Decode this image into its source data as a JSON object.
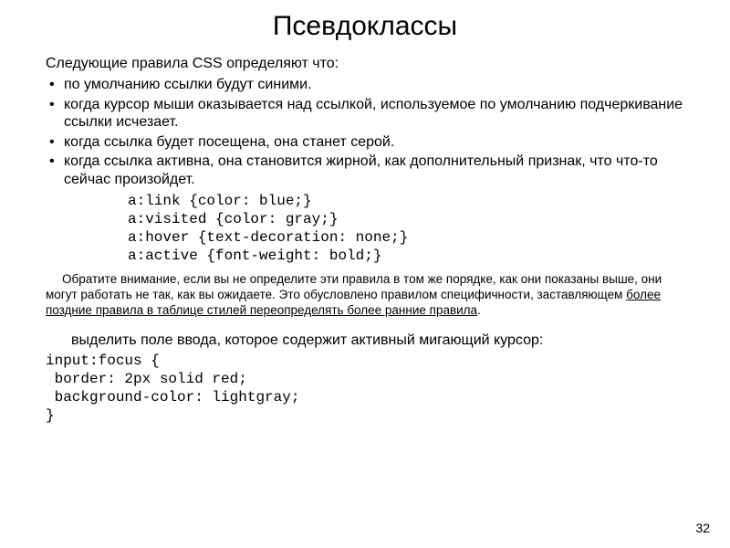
{
  "title": "Псевдоклассы",
  "intro": "Следующие правила CSS определяют что:",
  "bullets": [
    "по умолчанию ссылки будут синими.",
    "когда курсор мыши оказывается над ссылкой, используемое по умолчанию подчеркивание ссылки исчезает.",
    "когда ссылка будет посещена, она станет серой.",
    "когда ссылка активна, она становится жирной, как дополнительный признак, что что-то сейчас произойдет."
  ],
  "code1": [
    "a:link {color: blue;}",
    "a:visited {color: gray;}",
    "a:hover {text-decoration: none;}",
    "a:active {font-weight: bold;}"
  ],
  "note_plain": "Обратите внимание, если вы не определите эти правила в том же порядке, как они показаны выше, они могут работать не так, как вы ожидаете. Это обусловлено правилом специфичности, заставляющем ",
  "note_ul": "более поздние правила в таблице стилей переопределять более ранние правила",
  "note_end": ".",
  "focus_intro": "выделить поле ввода, которое содержит активный мигающий курсор:",
  "code2": [
    "input:focus {",
    " border: 2px solid red;",
    " background-color: lightgray;",
    "}"
  ],
  "page_number": "32"
}
